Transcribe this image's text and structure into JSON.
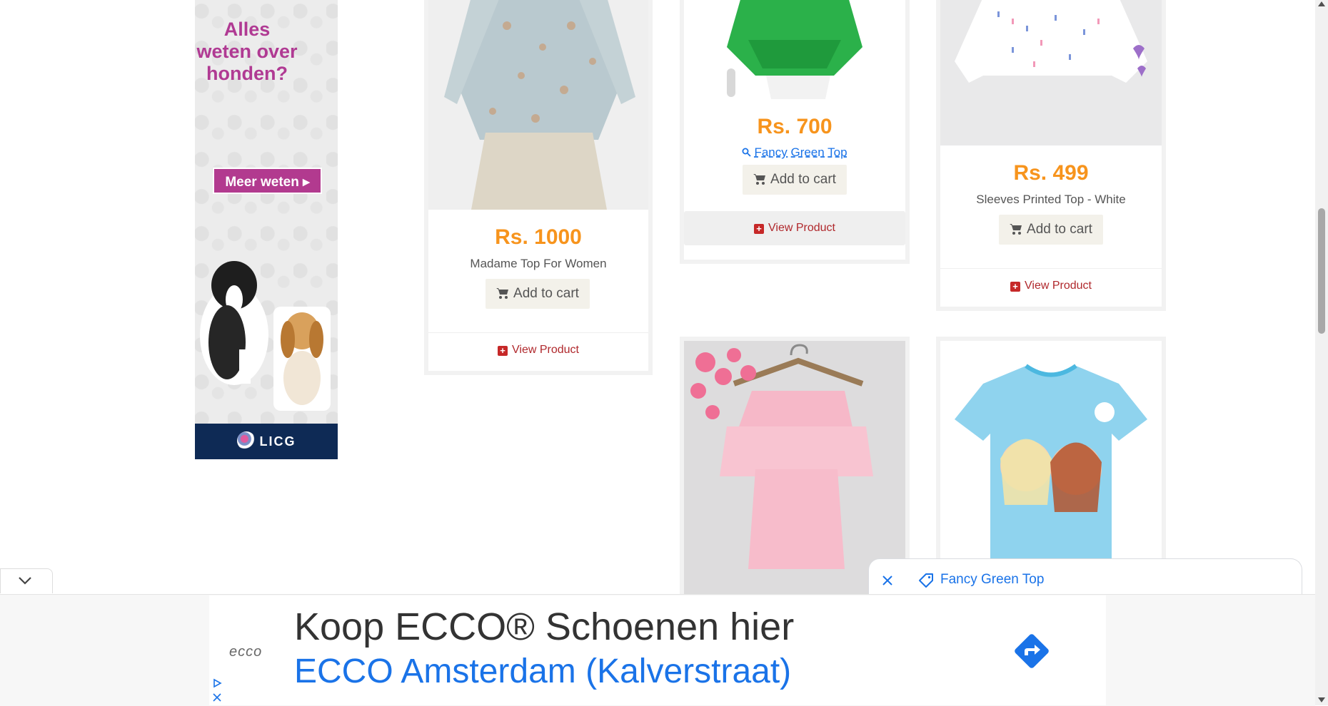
{
  "side_ad": {
    "headline": "Alles weten over honden?",
    "cta": "Meer weten",
    "brand": "LICG"
  },
  "products": [
    {
      "price": "Rs. 1000",
      "name": "Madame Top For Women",
      "add_to_cart": "Add to cart",
      "view": "View Product"
    },
    {
      "price": "Rs. 700",
      "name": "Fancy Green Top",
      "add_to_cart": "Add to cart",
      "view": "View Product"
    },
    {
      "price": "Rs. 499",
      "name": "Sleeves Printed Top - White",
      "add_to_cart": "Add to cart",
      "view": "View Product"
    }
  ],
  "search_chip": {
    "label": "Fancy Green Top"
  },
  "bottom_ad": {
    "logo": "ecco",
    "title": "Koop ECCO® Schoenen hier",
    "subtitle": "ECCO Amsterdam (Kalverstraat)"
  },
  "colors": {
    "price": "#f7941d",
    "link": "#1a73e8",
    "view_product": "#b0282c",
    "ad_pink": "#b23a8f"
  }
}
